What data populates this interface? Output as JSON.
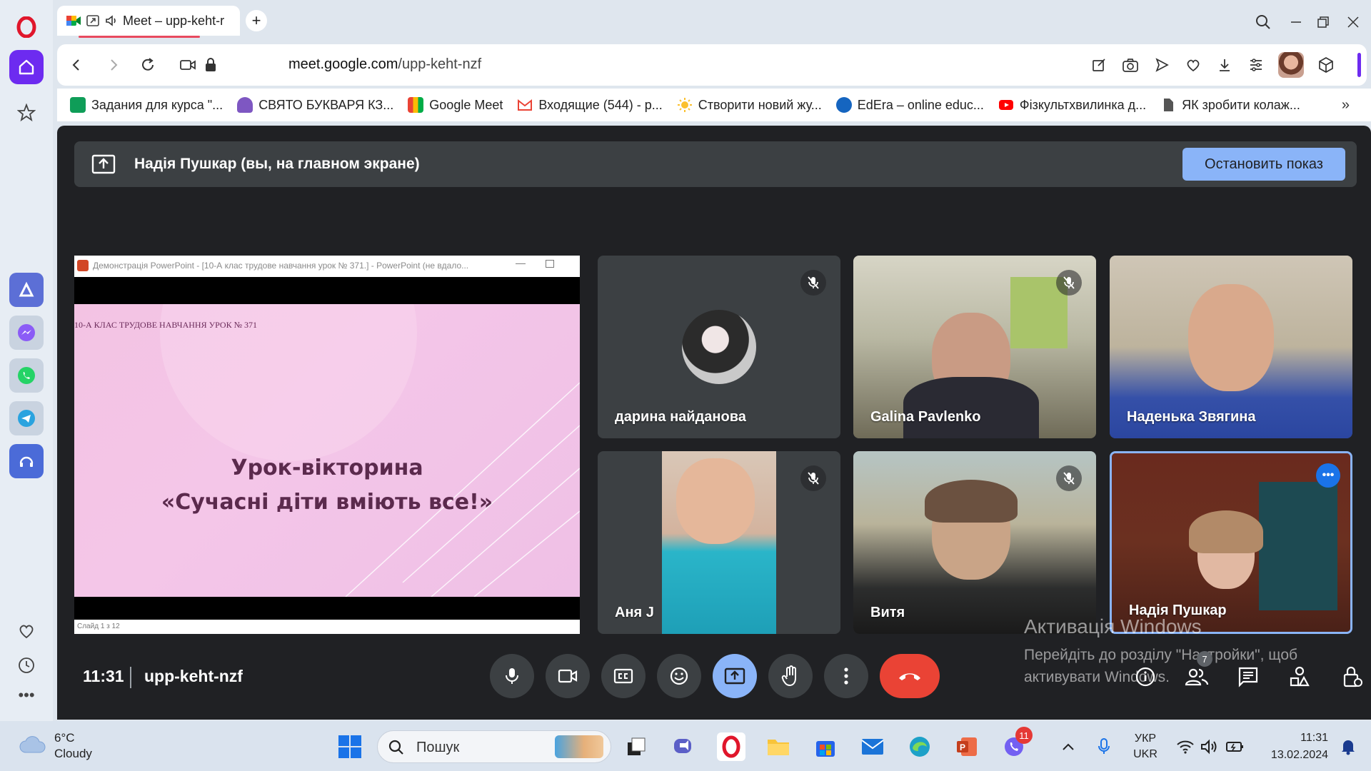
{
  "browser": {
    "tab": {
      "title": "Meet – upp-keht-r"
    },
    "address": {
      "host": "meet.google.com",
      "path": "/upp-keht-nzf"
    },
    "bookmarks": [
      {
        "label": "Задания для курса \"...",
        "color": "#f4b400"
      },
      {
        "label": "СВЯТО БУКВАРЯ КЗ...",
        "color": "#7e57c2"
      },
      {
        "label": "Google Meet",
        "color": "#00897b"
      },
      {
        "label": "Входящие (544) - р...",
        "color": "#ea4335"
      },
      {
        "label": "Створити новий жу...",
        "color": "#fbc02d"
      },
      {
        "label": "EdEra – online educ...",
        "color": "#1565c0"
      },
      {
        "label": "Фізкультхвилинка д...",
        "color": "#ff0000"
      },
      {
        "label": "ЯК зробити колаж...",
        "color": "#555555"
      }
    ]
  },
  "meet": {
    "banner_text": "Надія Пушкар (вы, на главном экране)",
    "stop_button": "Остановить показ",
    "time": "11:31",
    "code": "upp-keht-nzf",
    "participant_count": "7",
    "presentation": {
      "window_title": "Демонстрація PowerPoint - [10-А клас трудове навчання урок № 371.] - PowerPoint (не вдало...",
      "slide_header": "10-А КЛАС ТРУДОВЕ НАВЧАННЯ УРОК № 371",
      "slide_title1": "Урок-вікторина",
      "slide_title2": "«Сучасні діти вміють все!»",
      "status": "Слайд 1 з 12"
    },
    "participants": [
      {
        "name": "дарина найданова",
        "muted": true
      },
      {
        "name": "Galina Pavlenko",
        "muted": true
      },
      {
        "name": "Наденька Звягина",
        "muted": false
      },
      {
        "name": "Аня J",
        "muted": true
      },
      {
        "name": "Витя",
        "muted": true
      },
      {
        "name": "Надія Пушкар",
        "muted": false
      }
    ]
  },
  "watermark": {
    "title": "Активація Windows",
    "line1": "Перейдіть до розділу \"Настройки\", щоб",
    "line2": "активувати Windows."
  },
  "taskbar": {
    "weather_temp": "6°C",
    "weather_text": "Cloudy",
    "search_placeholder": "Пошук",
    "lang_top": "УКР",
    "lang_bottom": "UKR",
    "clock_time": "11:31",
    "clock_date": "13.02.2024",
    "viber_badge": "11"
  }
}
